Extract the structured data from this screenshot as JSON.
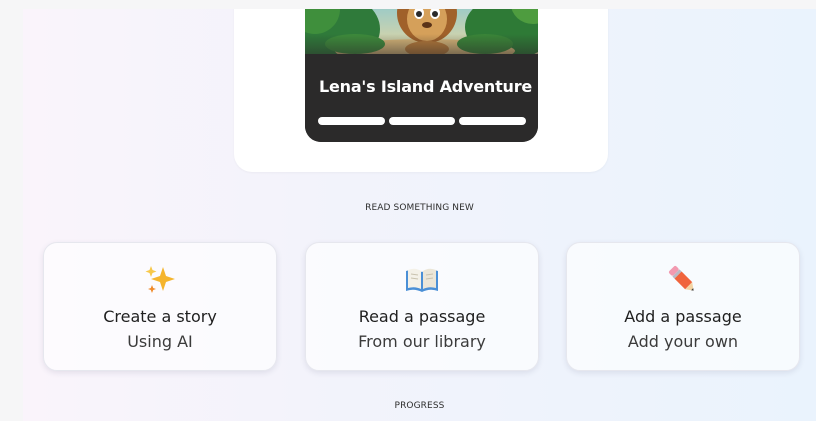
{
  "featured_story": {
    "title": "Lena's Island Adventure",
    "progress_segments_total": 3,
    "progress_segments_complete": 3
  },
  "sections": {
    "read_something_new": "READ SOMETHING NEW",
    "progress": "PROGRESS"
  },
  "actions": [
    {
      "title": "Create a story",
      "subtitle": "Using AI",
      "icon": "sparkles-icon"
    },
    {
      "title": "Read a passage",
      "subtitle": "From our library",
      "icon": "open-book-icon"
    },
    {
      "title": "Add a passage",
      "subtitle": "Add your own",
      "icon": "pencil-icon"
    }
  ],
  "colors": {
    "story_card_bg": "#2b2a2a",
    "card_bg": "#ffffff",
    "sparkle": "#f5b52e",
    "book": "#4a8fd6",
    "pencil": "#f0643c"
  }
}
